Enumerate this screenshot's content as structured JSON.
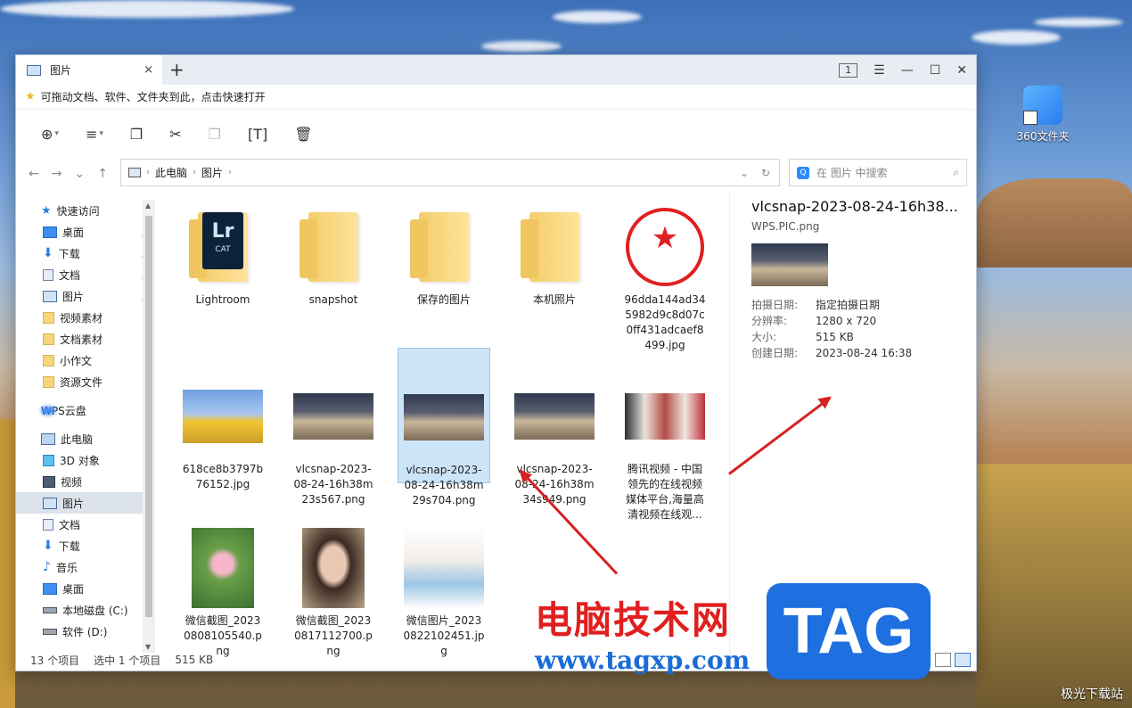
{
  "desktop": {
    "shortcut_label": "360文件夹"
  },
  "window": {
    "tab_title": "图片",
    "tab_close": "×",
    "new_tab": "+",
    "tab_count": "1",
    "menu_icon": "☰",
    "minimize": "—",
    "maximize": "☐",
    "close": "✕"
  },
  "favbar": {
    "text": "可拖动文档、软件、文件夹到此，点击快速打开"
  },
  "address": {
    "crumbs": [
      "此电脑",
      "图片"
    ]
  },
  "search": {
    "placeholder": "在 图片 中搜索"
  },
  "sidebar": {
    "items": [
      {
        "label": "快速访问",
        "icon": "star-icon"
      },
      {
        "label": "桌面",
        "icon": "desktop-icon",
        "pinned": true
      },
      {
        "label": "下载",
        "icon": "download-icon",
        "pinned": true
      },
      {
        "label": "文档",
        "icon": "document-icon",
        "pinned": true
      },
      {
        "label": "图片",
        "icon": "picture-icon",
        "pinned": true
      },
      {
        "label": "视频素材",
        "icon": "folder-icon"
      },
      {
        "label": "文档素材",
        "icon": "folder-icon"
      },
      {
        "label": "小作文",
        "icon": "folder-icon"
      },
      {
        "label": "资源文件",
        "icon": "folder-icon"
      },
      {
        "label": "WPS云盘",
        "icon": "cloud-icon"
      },
      {
        "label": "此电脑",
        "icon": "computer-icon"
      },
      {
        "label": "3D 对象",
        "icon": "cube-icon"
      },
      {
        "label": "视频",
        "icon": "video-icon"
      },
      {
        "label": "图片",
        "icon": "picture-icon",
        "selected": true
      },
      {
        "label": "文档",
        "icon": "document-icon"
      },
      {
        "label": "下载",
        "icon": "download-icon"
      },
      {
        "label": "音乐",
        "icon": "music-icon"
      },
      {
        "label": "桌面",
        "icon": "desktop-icon"
      },
      {
        "label": "本地磁盘 (C:)",
        "icon": "drive-icon"
      },
      {
        "label": "软件 (D:)",
        "icon": "drive-icon"
      }
    ]
  },
  "files": [
    {
      "name": "Lightroom",
      "kind": "folder-lightroom"
    },
    {
      "name": "snapshot",
      "kind": "folder"
    },
    {
      "name": "保存的图片",
      "kind": "folder"
    },
    {
      "name": "本机照片",
      "kind": "folder"
    },
    {
      "name": "96dda144ad345982d9c8d07c0ff431adcaef8499.jpg",
      "kind": "stamp"
    },
    {
      "name": "618ce8b3797b76152.jpg",
      "kind": "tulip"
    },
    {
      "name": "vlcsnap-2023-08-24-16h38m23s567.png",
      "kind": "room"
    },
    {
      "name": "vlcsnap-2023-08-24-16h38m29s704.png",
      "kind": "room",
      "selected": true
    },
    {
      "name": "vlcsnap-2023-08-24-16h38m34s949.png",
      "kind": "room"
    },
    {
      "name": "腾讯视频 - 中国领先的在线视频媒体平台,海量高清视频在线观...",
      "kind": "pair"
    },
    {
      "name": "微信截图_20230808105540.png",
      "kind": "lotus"
    },
    {
      "name": "微信截图_20230817112700.png",
      "kind": "face"
    },
    {
      "name": "微信图片_20230822102451.jpg",
      "kind": "girl"
    }
  ],
  "lightroom_text": {
    "big": "Lr",
    "small": "CAT"
  },
  "preview": {
    "title": "vlcsnap-2023-08-24-16h38...",
    "subtitle": "WPS.PIC.png",
    "rows": [
      {
        "k": "拍摄日期:",
        "v": "指定拍摄日期"
      },
      {
        "k": "分辨率:",
        "v": "1280 x 720"
      },
      {
        "k": "大小:",
        "v": "515 KB"
      },
      {
        "k": "创建日期:",
        "v": "2023-08-24 16:38"
      }
    ]
  },
  "status": {
    "count": "13 个项目",
    "selected": "选中 1 个项目",
    "size": "515 KB"
  },
  "watermark": {
    "cn": "电脑技术网",
    "url": "www.tagxp.com",
    "tag": "TAG",
    "corner": "极光下载站"
  },
  "colors": {
    "accent": "#2b7de0",
    "selected_bg": "#cce4f8",
    "arrow": "#d62222"
  }
}
